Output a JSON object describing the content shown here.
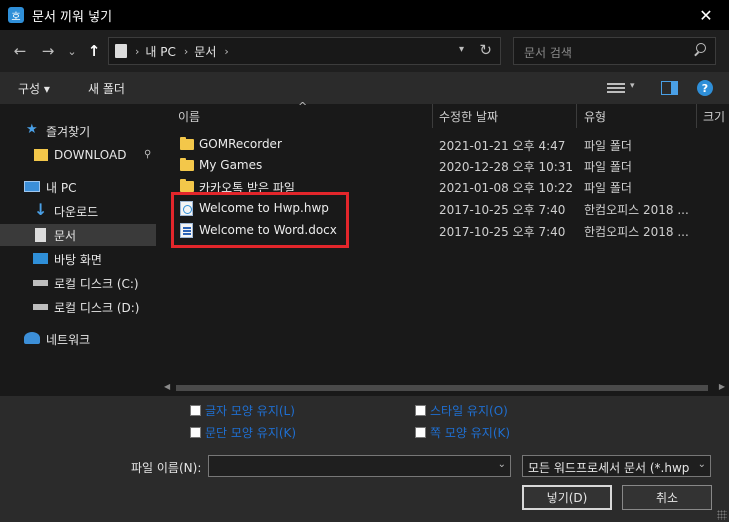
{
  "window": {
    "title": "문서 끼워 넣기",
    "app_icon_glyph": "호",
    "close_glyph": "✕"
  },
  "nav": {
    "back_glyph": "←",
    "forward_glyph": "→",
    "recent_glyph": "⌄",
    "up_glyph": "↑",
    "breadcrumb": [
      "내 PC",
      "문서"
    ],
    "crumb_sep": "›",
    "refresh_glyph": "↻",
    "search_placeholder": "문서 검색"
  },
  "toolbar": {
    "organize": "구성 ▾",
    "new_folder": "새 폴더",
    "view_drop": "▾",
    "help": "?"
  },
  "sidebar": {
    "items": [
      {
        "label": "즐겨찾기",
        "icon": "star-icon"
      },
      {
        "label": "DOWNLOAD",
        "icon": "folder-icon"
      },
      {
        "label": "내 PC",
        "icon": "pc-icon"
      },
      {
        "label": "다운로드",
        "icon": "download-icon"
      },
      {
        "label": "문서",
        "icon": "document-icon"
      },
      {
        "label": "바탕 화면",
        "icon": "desktop-icon"
      },
      {
        "label": "로컬 디스크 (C:)",
        "icon": "drive-icon"
      },
      {
        "label": "로컬 디스크 (D:)",
        "icon": "drive-icon"
      },
      {
        "label": "네트워크",
        "icon": "network-icon"
      }
    ],
    "pin_glyph": "📌"
  },
  "columns": {
    "name": "이름",
    "modified": "수정한 날짜",
    "type": "유형",
    "size": "크기"
  },
  "files": [
    {
      "name": "GOMRecorder",
      "date": "2021-01-21 오후 4:47",
      "type": "파일 폴더",
      "kind": "folder"
    },
    {
      "name": "My Games",
      "date": "2020-12-28 오후 10:31",
      "type": "파일 폴더",
      "kind": "folder"
    },
    {
      "name": "카카오톡 받은 파일",
      "date": "2021-01-08 오후 10:22",
      "type": "파일 폴더",
      "kind": "folder"
    },
    {
      "name": "Welcome to Hwp.hwp",
      "date": "2017-10-25 오후 7:40",
      "type": "한컴오피스 2018 ...",
      "kind": "hwp"
    },
    {
      "name": "Welcome to Word.docx",
      "date": "2017-10-25 오후 7:40",
      "type": "한컴오피스 2018 ...",
      "kind": "doc"
    }
  ],
  "options": {
    "keep_char_shape": "글자 모양 유지(L)",
    "keep_para_shape": "문단 모양 유지(K)",
    "keep_style": "스타일 유지(O)",
    "keep_page_shape": "쪽 모양 유지(K)"
  },
  "filename": {
    "label": "파일 이름(N):",
    "value": ""
  },
  "filetype": {
    "selected": "모든 워드프로세서 문서 (*.hwp"
  },
  "buttons": {
    "insert": "넣기(D)",
    "cancel": "취소"
  },
  "colors": {
    "highlight": "#e3262b",
    "link": "#1f6fd1",
    "accent": "#2f8fd8"
  }
}
